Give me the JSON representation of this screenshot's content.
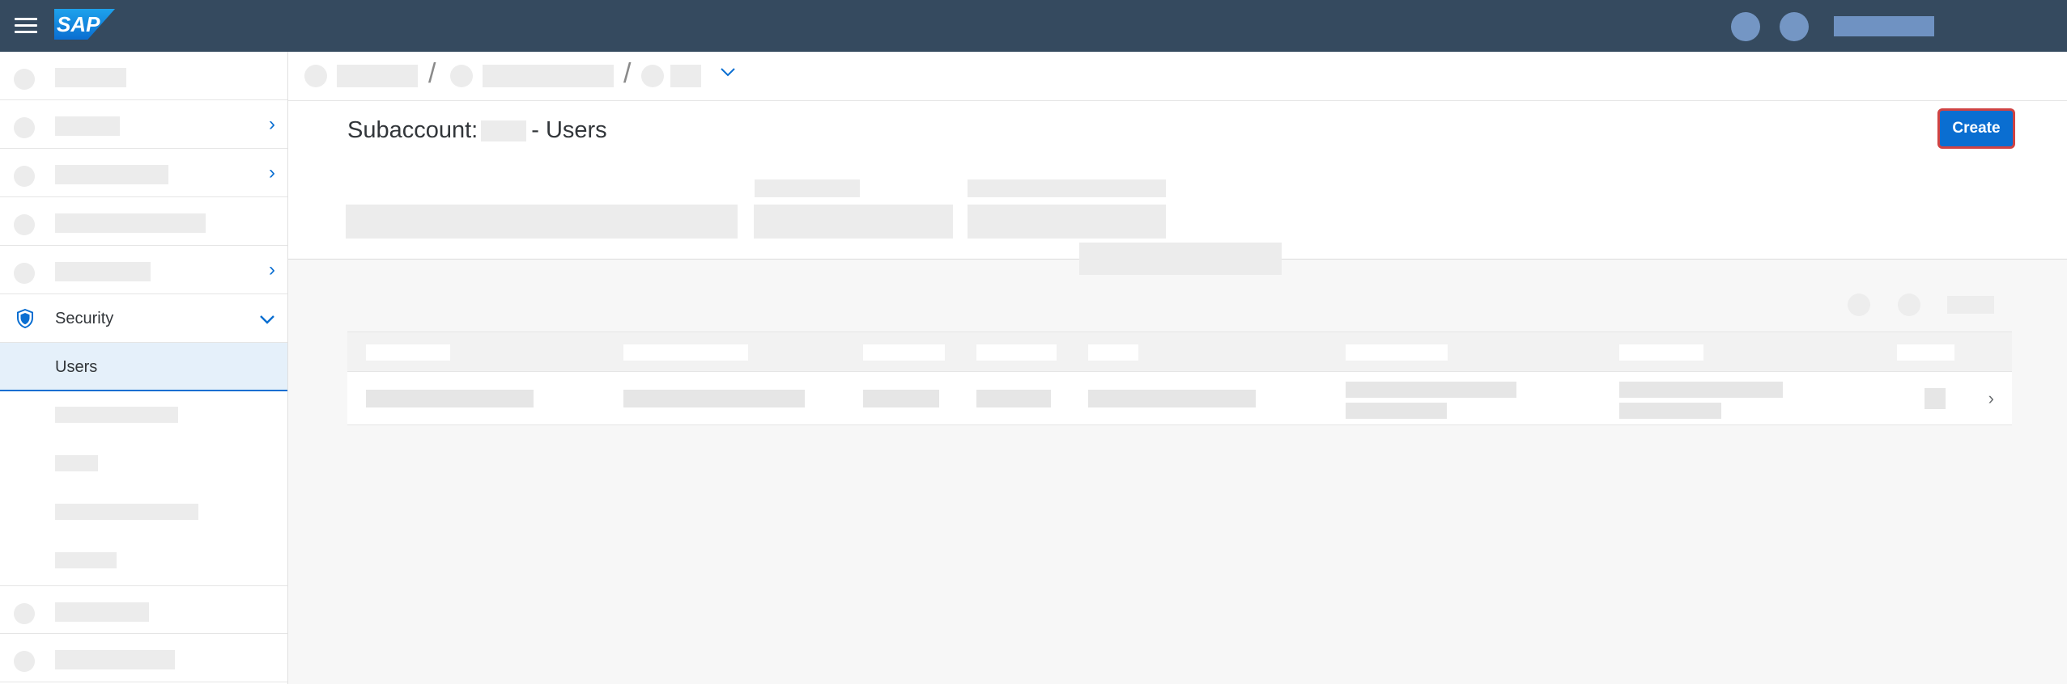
{
  "shellbar": {
    "logo_text": "SAP",
    "menu_icon": "hamburger-menu-icon",
    "colors": {
      "background": "#354a5f",
      "logo": "#0a6ed1"
    }
  },
  "sidebar": {
    "selected_group": {
      "label": "Security",
      "icon": "shield-icon",
      "expanded": true
    },
    "selected_item": {
      "label": "Users"
    },
    "colors": {
      "accent": "#0a6ed1",
      "selected_background": "#e5f0fa"
    }
  },
  "header": {
    "title_prefix": "Subaccount:",
    "title_suffix": "- Users",
    "create_label": "Create"
  },
  "breadcrumb": {
    "dropdown_icon": "chevron-down-icon"
  }
}
